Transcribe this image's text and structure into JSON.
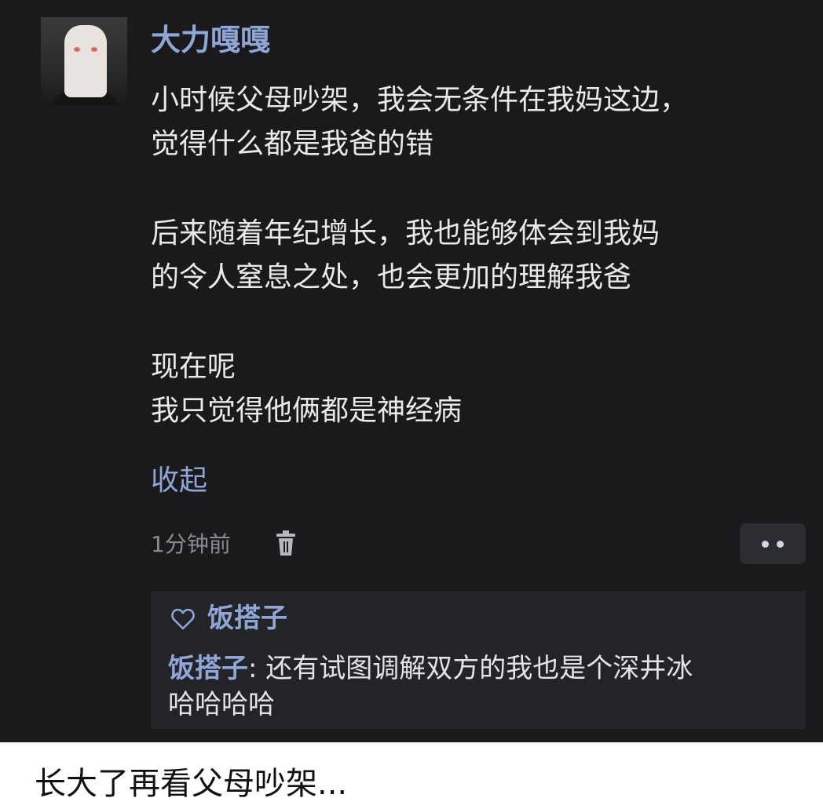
{
  "post": {
    "username": "大力嘎嘎",
    "paragraphs": [
      "小时候父母吵架，我会无条件在我妈这边，\n觉得什么都是我爸的错",
      "后来随着年纪增长，我也能够体会到我妈\n的令人窒息之处，也会更加的理解我爸",
      "现在呢\n我只觉得他俩都是神经病"
    ],
    "collapse_label": "收起",
    "time": "1分钟前",
    "icons": {
      "trash": "trash-icon",
      "more": "more-icon",
      "like": "heart-icon"
    }
  },
  "reply_box": {
    "liked_by": "饭搭子",
    "reply_author": "饭搭子",
    "reply_separator": ": ",
    "reply_text": "还有试图调解双方的我也是个深井冰\n哈哈哈哈"
  },
  "caption": "长大了再看父母吵架...",
  "colors": {
    "background": "#1a1a1c",
    "link": "#8fa6d6",
    "text": "#e9e9ea",
    "muted": "#8c8c90",
    "reply_bg": "#232428"
  }
}
